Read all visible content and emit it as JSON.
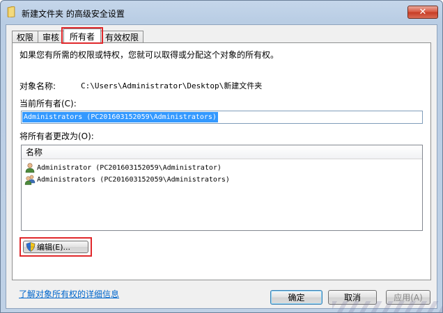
{
  "window": {
    "title": "新建文件夹 的高级安全设置",
    "close_label": "✕"
  },
  "tabs": [
    {
      "label": "权限",
      "active": false
    },
    {
      "label": "审核",
      "active": false
    },
    {
      "label": "所有者",
      "active": true
    },
    {
      "label": "有效权限",
      "active": false
    }
  ],
  "owner": {
    "description": "如果您有所需的权限或特权，您就可以取得或分配这个对象的所有权。",
    "object_name_label": "对象名称:",
    "object_name_value": "C:\\Users\\Administrator\\Desktop\\新建文件夹",
    "current_owner_label": "当前所有者(C):",
    "current_owner_value": "Administrators (PC201603152059\\Administrators)",
    "change_owner_label": "将所有者更改为(O):",
    "list_header": "名称",
    "list_items": [
      {
        "name": "Administrator (PC201603152059\\Administrator)",
        "icon": "user-icon"
      },
      {
        "name": "Administrators (PC201603152059\\Administrators)",
        "icon": "group-icon"
      }
    ],
    "edit_button": "编辑(E)...",
    "learn_link": "了解对象所有权的详细信息"
  },
  "buttons": {
    "ok": "确定",
    "cancel": "取消",
    "apply": "应用(A)"
  },
  "colors": {
    "highlight": "#e0272a",
    "selection": "#3399ff",
    "link": "#0066cc"
  }
}
